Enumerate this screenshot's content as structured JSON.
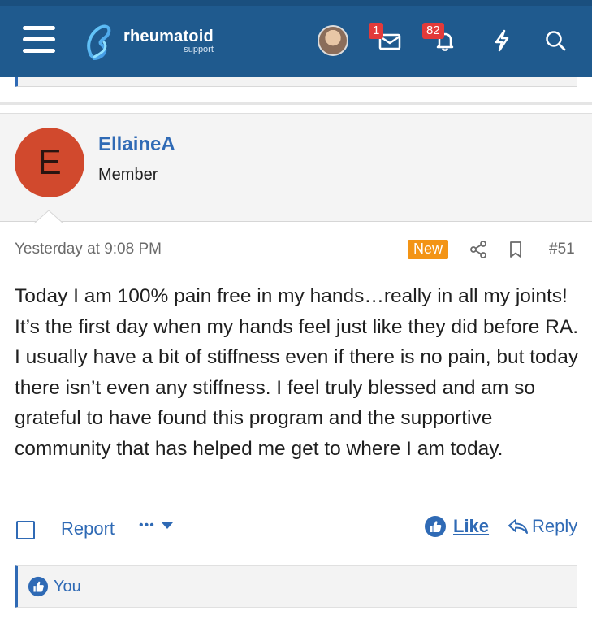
{
  "header": {
    "logo_name": "rheumatoid",
    "logo_sub": "support",
    "inbox_badge": "1",
    "alerts_badge": "82"
  },
  "post": {
    "author": "EllaineA",
    "author_initial": "E",
    "author_title": "Member",
    "timestamp": "Yesterday at 9:08 PM",
    "new_label": "New",
    "post_number": "#51",
    "body": "Today I am 100% pain free in my hands…really in all my joints! It’s the first day when my hands feel just like they did before RA. I usually have a bit of stiffness even if there is no pain, but today there isn’t even any stiffness. I feel truly blessed and am so grateful to have found this program and the supportive community that has helped me get to where I am today."
  },
  "actions": {
    "report_label": "Report",
    "more_label": "•••",
    "like_label": "Like",
    "reply_label": "Reply"
  },
  "reactions": {
    "text": "You"
  },
  "colors": {
    "header_bg": "#1f5a8e",
    "link": "#2f6ab5",
    "avatar_bg": "#d1492d",
    "new_badge": "#f39415",
    "badge_red": "#e23a3a"
  }
}
